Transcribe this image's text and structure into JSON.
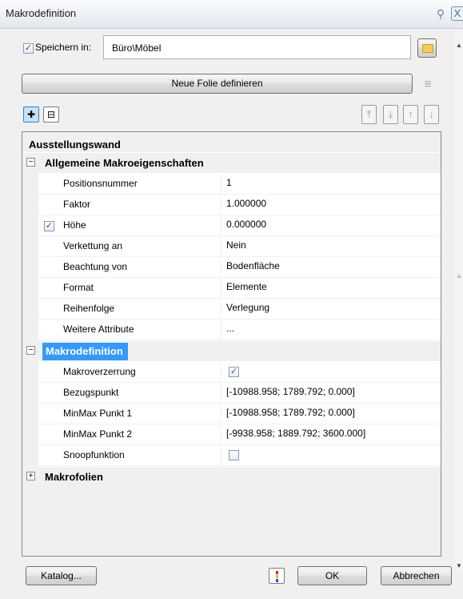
{
  "window": {
    "title": "Makrodefinition",
    "pin_icon": "pin-icon",
    "close_icon": "close-icon",
    "close_glyph": "X",
    "pin_glyph": "⚲"
  },
  "save": {
    "checked_glyph": "✓",
    "label": "Speichern in:",
    "path": "Büro\\Möbel",
    "folder_icon": "folder-icon"
  },
  "toolbar": {
    "new_foil_label": "Neue Folie definieren",
    "foil_icon_glyph": "≡",
    "add_glyph": "✚",
    "remove_glyph": "⊟",
    "move_top_glyph": "⤒",
    "move_bottom_glyph": "⤓",
    "move_up_glyph": "↑",
    "move_down_glyph": "↓"
  },
  "grid": {
    "root_title": "Ausstellungswand",
    "collapse_glyph": "−",
    "expand_glyph": "+",
    "sections": [
      {
        "title": "Allgemeine Makroeigenschaften",
        "rows": [
          {
            "name": "Positionsnummer",
            "value": "1"
          },
          {
            "name": "Faktor",
            "value": "1.000000"
          },
          {
            "name": "Höhe",
            "value": "0.000000",
            "checked": true
          },
          {
            "name": "Verkettung an",
            "value": "Nein"
          },
          {
            "name": "Beachtung von",
            "value": "Bodenfläche"
          },
          {
            "name": "Format",
            "value": "Elemente"
          },
          {
            "name": "Reihenfolge",
            "value": "Verlegung"
          },
          {
            "name": "Weitere Attribute",
            "value": "..."
          }
        ]
      },
      {
        "title": "Makrodefinition",
        "rows": [
          {
            "name": "Makroverzerrung",
            "value_checkbox": true
          },
          {
            "name": "Bezugspunkt",
            "value": "[-10988.958; 1789.792; 0.000]"
          },
          {
            "name": "MinMax Punkt 1",
            "value": "[-10988.958; 1789.792; 0.000]"
          },
          {
            "name": "MinMax Punkt 2",
            "value": "[-9938.958; 1889.792; 3600.000]"
          },
          {
            "name": "Snoopfunktion",
            "value_checkbox": false
          }
        ]
      },
      {
        "title": "Makrofolien",
        "collapsed": true
      }
    ]
  },
  "footer": {
    "catalog_label": "Katalog...",
    "ok_label": "OK",
    "cancel_label": "Abbrechen",
    "color_icon": "color-dots-icon"
  },
  "colors": {
    "selection": "#3399ff",
    "checkmark": "#2c4fa8"
  }
}
